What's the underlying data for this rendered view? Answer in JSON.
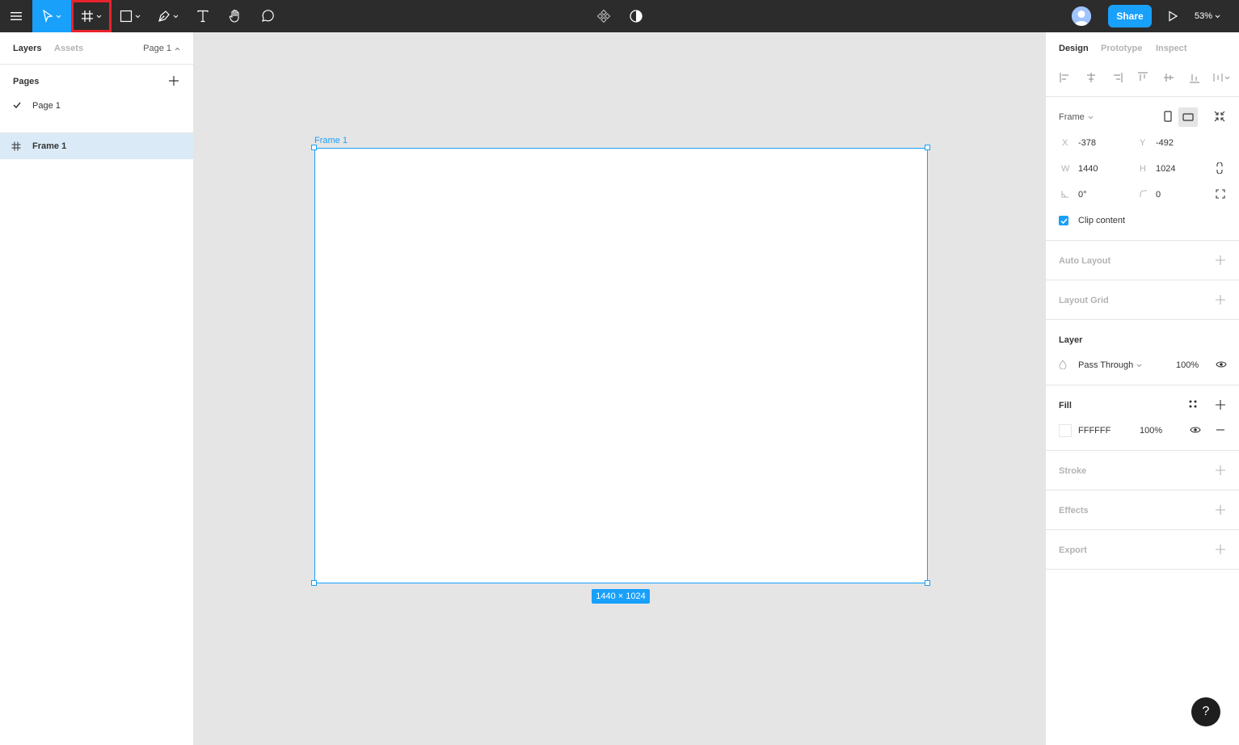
{
  "colors": {
    "accent": "#18a0fb",
    "toolbar_bg": "#2c2c2c",
    "highlight": "#e8232c",
    "canvas_bg": "#e5e5e5",
    "layer_selected": "#daebf7"
  },
  "toolbar": {
    "icons": [
      "menu-icon",
      "move-icon",
      "frame-icon",
      "rectangle-icon",
      "pen-icon",
      "text-icon",
      "hand-icon",
      "comment-icon",
      "components-icon",
      "contrast-icon",
      "play-icon"
    ],
    "share_label": "Share",
    "zoom": "53%"
  },
  "left_panel": {
    "tabs": {
      "layers": "Layers",
      "assets": "Assets"
    },
    "page_selector": "Page 1",
    "pages_title": "Pages",
    "pages": [
      {
        "label": "Page 1",
        "selected": true
      }
    ],
    "layers": [
      {
        "label": "Frame 1",
        "selected": true
      }
    ]
  },
  "canvas": {
    "frame_label": "Frame 1",
    "size_badge": "1440 × 1024"
  },
  "right_panel": {
    "tabs": {
      "design": "Design",
      "prototype": "Prototype",
      "inspect": "Inspect"
    },
    "frame": {
      "type_label": "Frame",
      "x_label": "X",
      "x": "-378",
      "y_label": "Y",
      "y": "-492",
      "w_label": "W",
      "w": "1440",
      "h_label": "H",
      "h": "1024",
      "rotation": "0°",
      "radius": "0",
      "clip_label": "Clip content"
    },
    "auto_layout": "Auto Layout",
    "layout_grid": "Layout Grid",
    "layer": {
      "title": "Layer",
      "blend": "Pass Through",
      "opacity": "100%"
    },
    "fill": {
      "title": "Fill",
      "hex": "FFFFFF",
      "opacity": "100%"
    },
    "stroke": "Stroke",
    "effects": "Effects",
    "export": "Export"
  },
  "help": "?"
}
